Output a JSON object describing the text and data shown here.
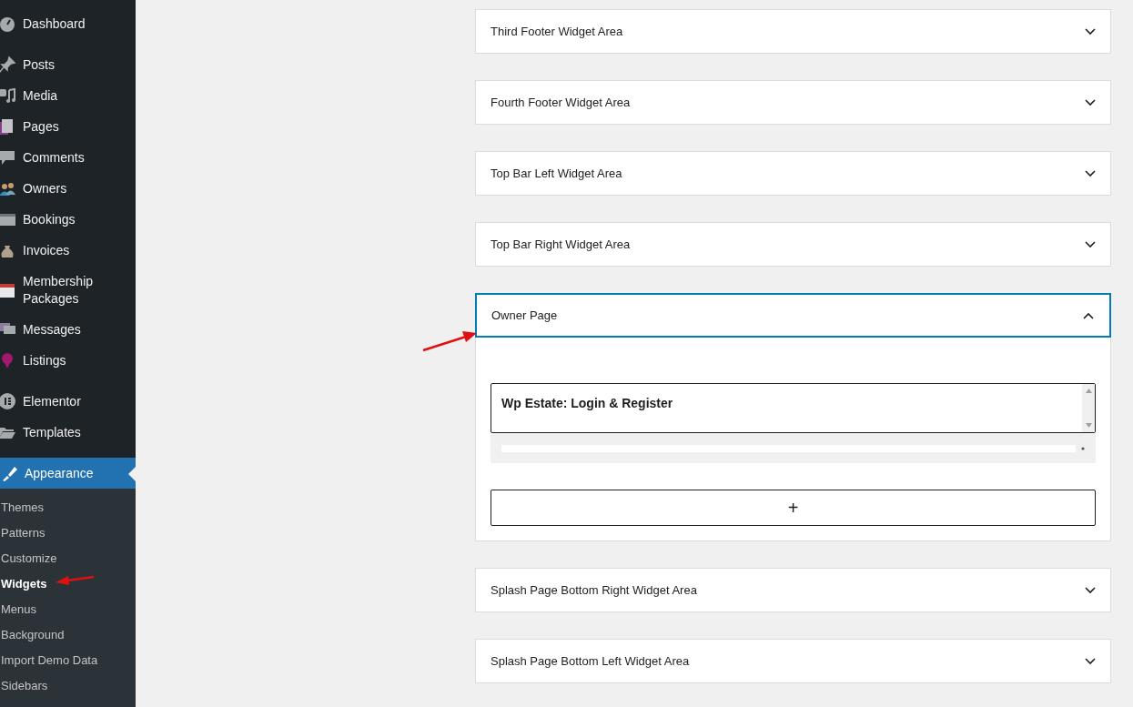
{
  "sidebar": {
    "groups": [
      [
        {
          "label": "Dashboard",
          "selected": false
        }
      ],
      [
        {
          "label": "Posts",
          "selected": false
        },
        {
          "label": "Media",
          "selected": false
        },
        {
          "label": "Pages",
          "selected": false
        },
        {
          "label": "Comments",
          "selected": false
        },
        {
          "label": "Owners",
          "selected": false
        },
        {
          "label": "Bookings",
          "selected": false
        },
        {
          "label": "Invoices",
          "selected": false
        },
        {
          "label": "Membership Packages",
          "selected": false
        },
        {
          "label": "Messages",
          "selected": false
        },
        {
          "label": "Listings",
          "selected": false
        }
      ],
      [
        {
          "label": "Elementor",
          "selected": false
        },
        {
          "label": "Templates",
          "selected": false
        }
      ]
    ],
    "current": {
      "label": "Appearance",
      "selected": true,
      "submenu": [
        {
          "label": "Themes",
          "selected": false
        },
        {
          "label": "Patterns",
          "selected": false
        },
        {
          "label": "Customize",
          "selected": false
        },
        {
          "label": "Widgets",
          "selected": true
        },
        {
          "label": "Menus",
          "selected": false
        },
        {
          "label": "Background",
          "selected": false
        },
        {
          "label": "Import Demo Data",
          "selected": false
        },
        {
          "label": "Sidebars",
          "selected": false
        }
      ]
    }
  },
  "widget_areas": [
    {
      "title": "Third Footer Widget Area",
      "expanded": false
    },
    {
      "title": "Fourth Footer Widget Area",
      "expanded": false
    },
    {
      "title": "Top Bar Left Widget Area",
      "expanded": false
    },
    {
      "title": "Top Bar Right Widget Area",
      "expanded": false
    },
    {
      "title": "Owner Page",
      "expanded": true,
      "widgets": [
        {
          "title": "Wp Estate: Login & Register"
        }
      ],
      "add_label": "+"
    },
    {
      "title": "Splash Page Bottom Right Widget Area",
      "expanded": false
    },
    {
      "title": "Splash Page Bottom Left Widget Area",
      "expanded": false
    }
  ]
}
